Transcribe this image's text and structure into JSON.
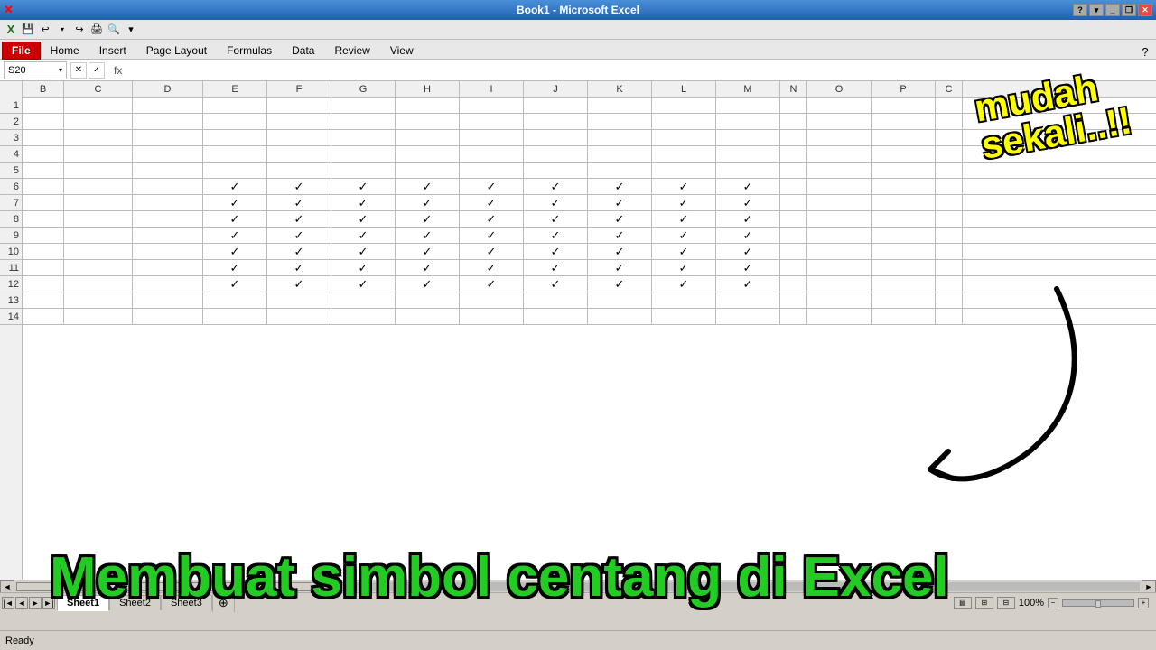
{
  "titlebar": {
    "title": "Book1 - Microsoft Excel",
    "win_buttons": [
      "minimize",
      "restore",
      "close"
    ]
  },
  "quickaccess": {
    "icons": [
      "save",
      "undo",
      "undo-arrow",
      "redo",
      "print",
      "preview",
      "customize"
    ]
  },
  "ribbon": {
    "tabs": [
      "File",
      "Home",
      "Insert",
      "Page Layout",
      "Formulas",
      "Data",
      "Review",
      "View"
    ],
    "active_tab": "File"
  },
  "formula_bar": {
    "name_box": "S20",
    "formula": ""
  },
  "columns": [
    "B",
    "C",
    "D",
    "E",
    "F",
    "G",
    "H",
    "I",
    "J",
    "K",
    "L",
    "M",
    "N",
    "O",
    "P",
    "C"
  ],
  "rows": [
    "1",
    "2",
    "3",
    "4",
    "5",
    "6",
    "7",
    "8",
    "9",
    "10",
    "11",
    "12",
    "13",
    "14"
  ],
  "checkmark": "✓",
  "overlay": {
    "mudah_line1": "mudah",
    "mudah_line2": "sekali..!!",
    "centang_text": "Membuat simbol centang di Excel"
  },
  "sheets": [
    "Sheet1",
    "Sheet2",
    "Sheet3"
  ],
  "active_sheet": "Sheet1",
  "status": "Ready",
  "zoom": "100%",
  "checkmark_rows": [
    6,
    7,
    8,
    9,
    10,
    11,
    12
  ],
  "checkmark_cols": [
    "E",
    "F",
    "G",
    "H",
    "I",
    "J",
    "K",
    "L",
    "M"
  ]
}
